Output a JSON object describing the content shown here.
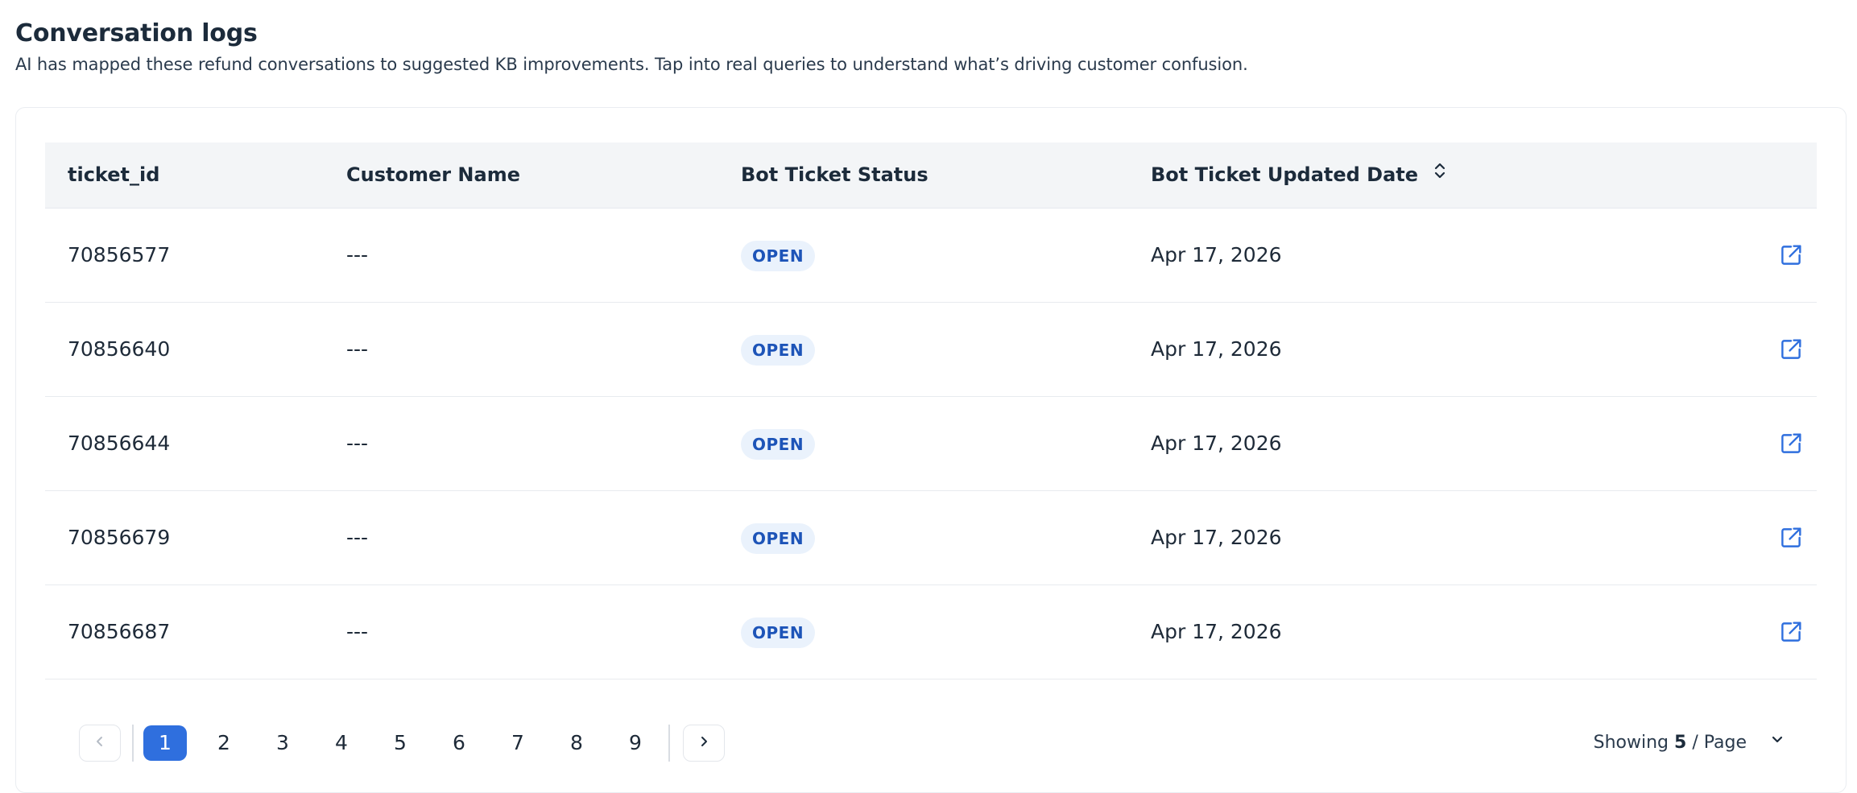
{
  "header": {
    "title": "Conversation logs",
    "subtitle": "AI has mapped these refund conversations to suggested KB improvements. Tap into real queries to understand what’s driving customer confusion."
  },
  "table": {
    "columns": {
      "ticket_id": "ticket_id",
      "customer_name": "Customer Name",
      "status": "Bot Ticket Status",
      "updated": "Bot Ticket Updated Date"
    },
    "rows": [
      {
        "ticket_id": "70856577",
        "customer_name": "---",
        "status": "OPEN",
        "updated": "Apr 17, 2026"
      },
      {
        "ticket_id": "70856640",
        "customer_name": "---",
        "status": "OPEN",
        "updated": "Apr 17, 2026"
      },
      {
        "ticket_id": "70856644",
        "customer_name": "---",
        "status": "OPEN",
        "updated": "Apr 17, 2026"
      },
      {
        "ticket_id": "70856679",
        "customer_name": "---",
        "status": "OPEN",
        "updated": "Apr 17, 2026"
      },
      {
        "ticket_id": "70856687",
        "customer_name": "---",
        "status": "OPEN",
        "updated": "Apr 17, 2026"
      }
    ]
  },
  "pagination": {
    "pages": [
      "1",
      "2",
      "3",
      "4",
      "5",
      "6",
      "7",
      "8",
      "9"
    ],
    "current": "1",
    "showing_prefix": "Showing",
    "page_size": "5",
    "showing_suffix": "/ Page"
  },
  "colors": {
    "accent": "#2f6fde",
    "badge_bg": "#eaf2fc",
    "badge_text": "#1d54b8",
    "header_bg": "#f3f5f7"
  },
  "icons": {
    "sort": "sort-updown-icon",
    "open": "external-link-icon",
    "prev": "chevron-left-icon",
    "next": "chevron-right-icon",
    "dropdown": "chevron-down-icon"
  }
}
